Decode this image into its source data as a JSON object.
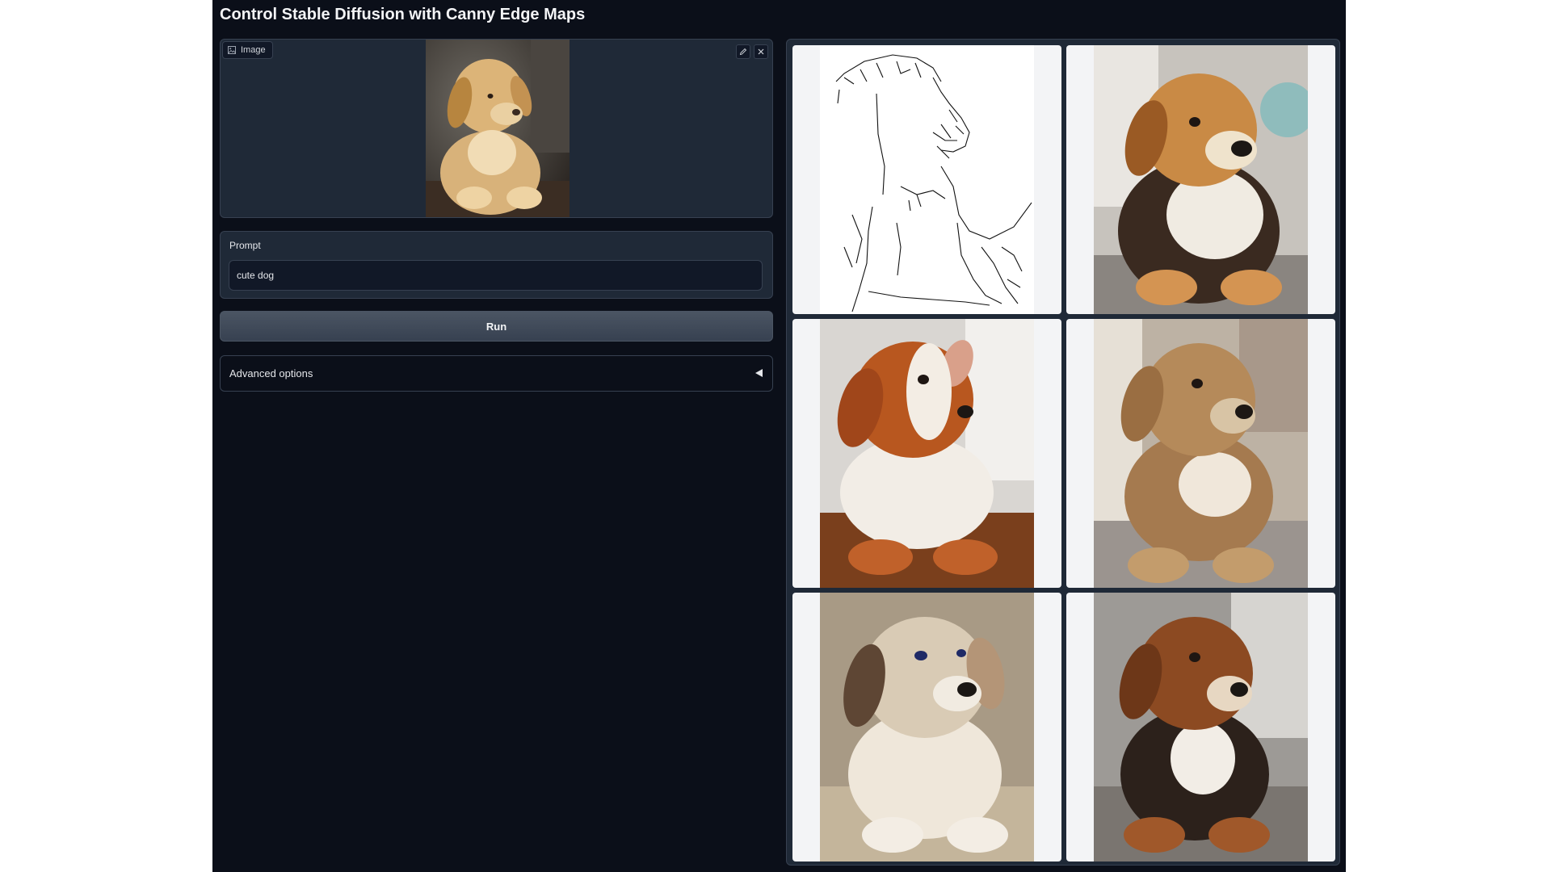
{
  "page": {
    "title": "Control Stable Diffusion with Canny Edge Maps"
  },
  "image_input": {
    "label": "Image",
    "label_icon": "image-icon",
    "edit_icon": "pencil-icon",
    "clear_icon": "close-icon"
  },
  "prompt": {
    "label": "Prompt",
    "value": "cute dog",
    "placeholder": ""
  },
  "run_button": {
    "label": "Run"
  },
  "advanced_options": {
    "label": "Advanced options",
    "expanded": false,
    "icon": "caret-left-icon"
  },
  "gallery": {
    "items": [
      {
        "kind": "canny-edge-map",
        "color": "#ffffff"
      },
      {
        "kind": "generated-dog",
        "fur": "#c98a45",
        "background": "#c7c3bd"
      },
      {
        "kind": "generated-dog",
        "fur": "#b8571f",
        "background": "#d9d6d2"
      },
      {
        "kind": "generated-dog",
        "fur": "#b58a5a",
        "background": "#bdb2a4"
      },
      {
        "kind": "generated-dog",
        "fur": "#d9cbb5",
        "background": "#a89a85"
      },
      {
        "kind": "generated-dog",
        "fur": "#8c4a22",
        "background": "#9d9a96"
      }
    ]
  },
  "colors": {
    "app_background": "#0b0f19",
    "panel_background": "#1f2937",
    "border": "#374151",
    "text": "#e5e7eb"
  }
}
